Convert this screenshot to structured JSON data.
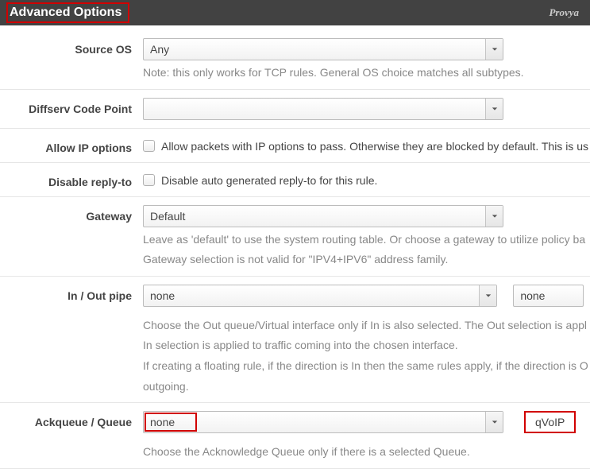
{
  "panel": {
    "title": "Advanced Options",
    "brand": "Provya"
  },
  "sourceOS": {
    "label": "Source OS",
    "value": "Any",
    "note": "Note: this only works for TCP rules. General OS choice matches all subtypes."
  },
  "diffserv": {
    "label": "Diffserv Code Point",
    "value": ""
  },
  "allowIP": {
    "label": "Allow IP options",
    "text": "Allow packets with IP options to pass. Otherwise they are blocked by default. This is us"
  },
  "disableReply": {
    "label": "Disable reply-to",
    "text": "Disable auto generated reply-to for this rule."
  },
  "gateway": {
    "label": "Gateway",
    "value": "Default",
    "note1": "Leave as 'default' to use the system routing table. Or choose a gateway to utilize policy ba",
    "note2": "Gateway selection is not valid for \"IPV4+IPV6\" address family."
  },
  "pipe": {
    "label": "In / Out pipe",
    "valueIn": "none",
    "valueOut": "none",
    "note1": "Choose the Out queue/Virtual interface only if In is also selected. The Out selection is appl",
    "note2": "In selection is applied to traffic coming into the chosen interface.",
    "note3": "If creating a floating rule, if the direction is In then the same rules apply, if the direction is O",
    "note4": "outgoing."
  },
  "ackqueue": {
    "label": "Ackqueue / Queue",
    "valueLeft": "none",
    "valueRight": "qVoIP",
    "note": "Choose the Acknowledge Queue only if there is a selected Queue."
  }
}
